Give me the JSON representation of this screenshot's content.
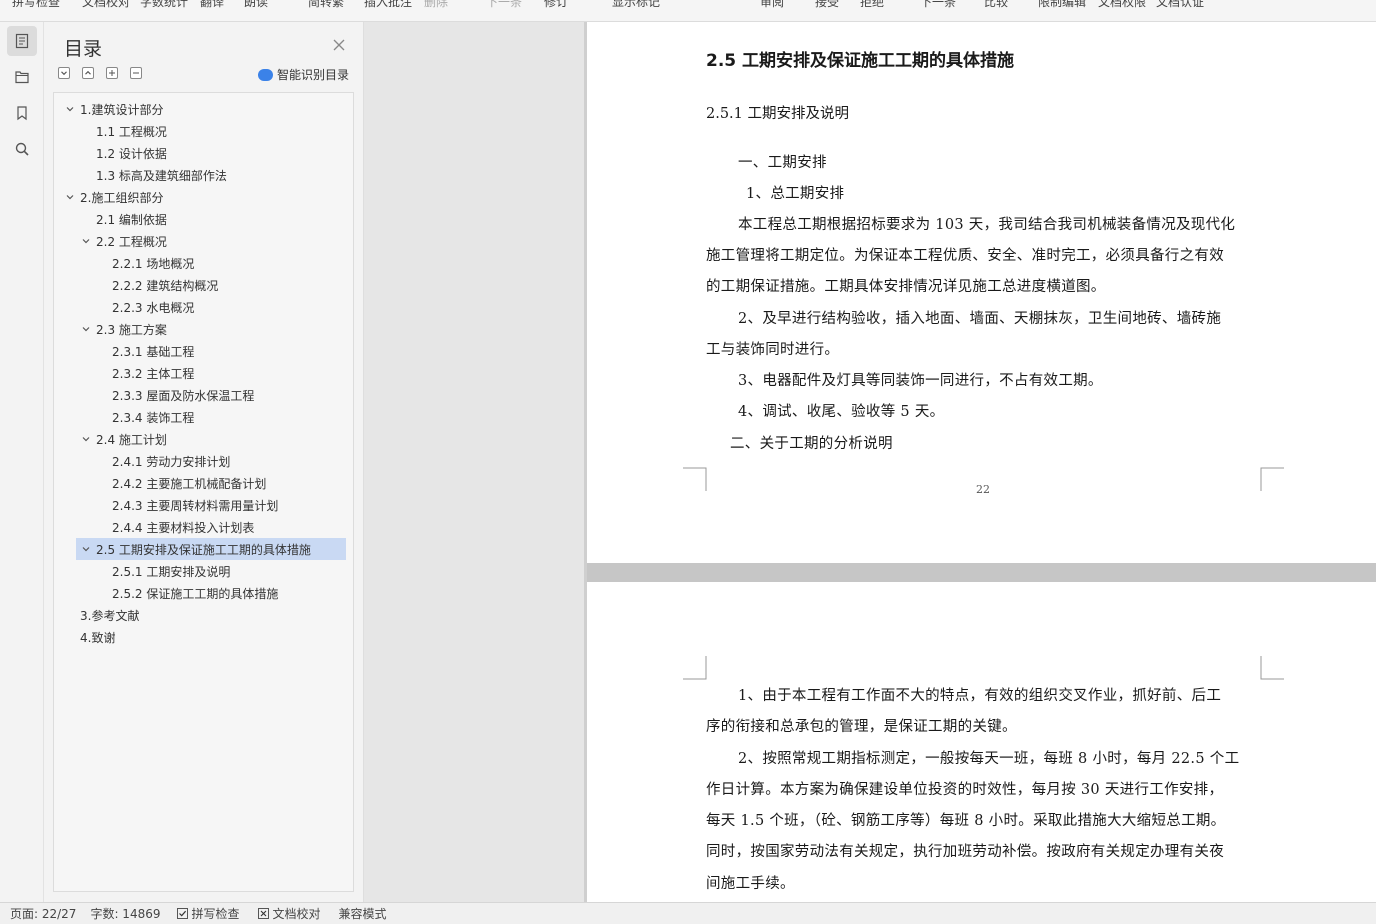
{
  "toolbar": {
    "items": [
      "拼写检查",
      "文档校对",
      "字数统计",
      "翻译",
      "朗读",
      "简转繁",
      "插入批注",
      "删除",
      "下一条",
      "修订",
      "显示标记",
      "审阅",
      "接受",
      "拒绝",
      "下一条",
      "比较",
      "限制编辑",
      "文档权限",
      "文档认证"
    ]
  },
  "toc": {
    "title": "目录",
    "smart_label": "智能识别目录",
    "items": [
      {
        "text": "1.建筑设计部分",
        "level": 1,
        "chevron": true
      },
      {
        "text": "1.1 工程概况",
        "level": 2,
        "chevron": false
      },
      {
        "text": "1.2 设计依据",
        "level": 2,
        "chevron": false
      },
      {
        "text": "1.3 标高及建筑细部作法",
        "level": 2,
        "chevron": false
      },
      {
        "text": "2.施工组织部分",
        "level": 1,
        "chevron": true
      },
      {
        "text": "2.1 编制依据",
        "level": 2,
        "chevron": false
      },
      {
        "text": "2.2 工程概况",
        "level": 2,
        "chevron": true
      },
      {
        "text": "2.2.1 场地概况",
        "level": 3,
        "chevron": false
      },
      {
        "text": "2.2.2 建筑结构概况",
        "level": 3,
        "chevron": false
      },
      {
        "text": "2.2.3 水电概况",
        "level": 3,
        "chevron": false
      },
      {
        "text": "2.3 施工方案",
        "level": 2,
        "chevron": true
      },
      {
        "text": "2.3.1 基础工程",
        "level": 3,
        "chevron": false
      },
      {
        "text": "2.3.2 主体工程",
        "level": 3,
        "chevron": false
      },
      {
        "text": "2.3.3 屋面及防水保温工程",
        "level": 3,
        "chevron": false
      },
      {
        "text": "2.3.4 装饰工程",
        "level": 3,
        "chevron": false
      },
      {
        "text": "2.4 施工计划",
        "level": 2,
        "chevron": true
      },
      {
        "text": "2.4.1  劳动力安排计划",
        "level": 3,
        "chevron": false
      },
      {
        "text": "2.4.2  主要施工机械配备计划",
        "level": 3,
        "chevron": false
      },
      {
        "text": "2.4.3  主要周转材料需用量计划",
        "level": 3,
        "chevron": false
      },
      {
        "text": "2.4.4  主要材料投入计划表",
        "level": 3,
        "chevron": false
      },
      {
        "text": "2.5 工期安排及保证施工工期的具体措施",
        "level": 2,
        "chevron": true,
        "selected": true
      },
      {
        "text": "2.5.1 工期安排及说明",
        "level": 3,
        "chevron": false
      },
      {
        "text": "2.5.2  保证施工工期的具体措施",
        "level": 3,
        "chevron": false
      },
      {
        "text": "3.参考文献",
        "level": 1,
        "chevron": false
      },
      {
        "text": "4.致谢",
        "level": 1,
        "chevron": false
      }
    ]
  },
  "page1": {
    "heading": "2.5 工期安排及保证施工工期的具体措施",
    "subheading": "2.5.1 工期安排及说明",
    "lines": [
      "一、工期安排",
      "1、总工期安排",
      "本工程总工期根据招标要求为 103 天，我司结合我司机械装备情况及现代化",
      "施工管理将工期定位。为保证本工程优质、安全、准时完工，必须具备行之有效",
      "的工期保证措施。工期具体安排情况详见施工总进度横道图。",
      "2、及早进行结构验收，插入地面、墙面、天棚抹灰，卫生间地砖、墙砖施",
      "工与装饰同时进行。",
      "3、电器配件及灯具等同装饰一同进行，不占有效工期。",
      "4、调试、收尾、验收等 5 天。",
      "二、关于工期的分析说明"
    ],
    "page_number": "22"
  },
  "page2": {
    "lines": [
      "1、由于本工程有工作面不大的特点，有效的组织交叉作业，抓好前、后工",
      "序的衔接和总承包的管理，是保证工期的关键。",
      "2、按照常规工期指标测定，一般按每天一班，每班 8 小时，每月 22.5 个工",
      "作日计算。本方案为确保建设单位投资的时效性，每月按 30 天进行工作安排，",
      "每天 1.5 个班，（砼、钢筋工序等）每班 8 小时。采取此措施大大缩短总工期。",
      "同时，按国家劳动法有关规定，执行加班劳动补偿。按政府有关规定办理有关夜",
      "间施工手续。"
    ]
  },
  "status": {
    "page": "页面: 22/27",
    "words": "字数: 14869",
    "spell": "拼写检查",
    "proof": "文档校对",
    "compat": "兼容模式"
  }
}
